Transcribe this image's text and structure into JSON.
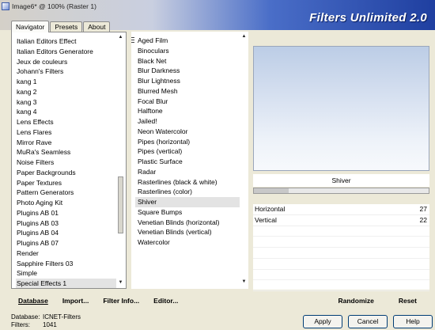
{
  "window": {
    "title": "Image6* @ 100% (Raster 1)",
    "brand": "Filters Unlimited 2.0"
  },
  "tabs": [
    {
      "label": "Navigator",
      "active": true
    },
    {
      "label": "Presets",
      "active": false
    },
    {
      "label": "About",
      "active": false
    }
  ],
  "categories": {
    "items": [
      "Italian Editors Effect",
      "Italian Editors Generatore",
      "Jeux de couleurs",
      "Johann's Filters",
      "kang 1",
      "kang 2",
      "kang 3",
      "kang 4",
      "Lens Effects",
      "Lens Flares",
      "Mirror Rave",
      "MuRa's Seamless",
      "Noise Filters",
      "Paper Backgrounds",
      "Paper Textures",
      "Pattern Generators",
      "Photo Aging Kit",
      "Plugins AB 01",
      "Plugins AB 03",
      "Plugins AB 04",
      "Plugins AB 07",
      "Render",
      "Sapphire Filters 03",
      "Simple",
      "Special Effects 1"
    ],
    "selected": "Special Effects 1"
  },
  "filters": {
    "items": [
      "Aged Film",
      "Binoculars",
      "Black Net",
      "Blur Darkness",
      "Blur Lightness",
      "Blurred Mesh",
      "Focal Blur",
      "Halftone",
      "Jailed!",
      "Neon Watercolor",
      "Pipes (horizontal)",
      "Pipes (vertical)",
      "Plastic Surface",
      "Radar",
      "Rasterlines (black & white)",
      "Rasterlines (color)",
      "Shiver",
      "Square Bumps",
      "Venetian Blinds (horizontal)",
      "Venetian Blinds (vertical)",
      "Watercolor"
    ],
    "selected": "Shiver"
  },
  "selected_filter": {
    "name": "Shiver",
    "progress": 0.2
  },
  "params": [
    {
      "label": "Horizontal",
      "value": "27"
    },
    {
      "label": "Vertical",
      "value": "22"
    }
  ],
  "toolbar": {
    "database_label": "Database",
    "import_label": "Import...",
    "filter_info_label": "Filter Info...",
    "editor_label": "Editor...",
    "randomize_label": "Randomize",
    "reset_label": "Reset"
  },
  "status": {
    "database_label": "Database:",
    "database_value": "ICNET-Filters",
    "filters_label": "Filters:",
    "filters_value": "1041"
  },
  "buttons": {
    "apply": "Apply",
    "cancel": "Cancel",
    "help": "Help"
  },
  "colors": {
    "brand_gradient_end": "#1f3fa0",
    "dialog_bg": "#ece9d8",
    "preview_top": "#bccde6"
  }
}
